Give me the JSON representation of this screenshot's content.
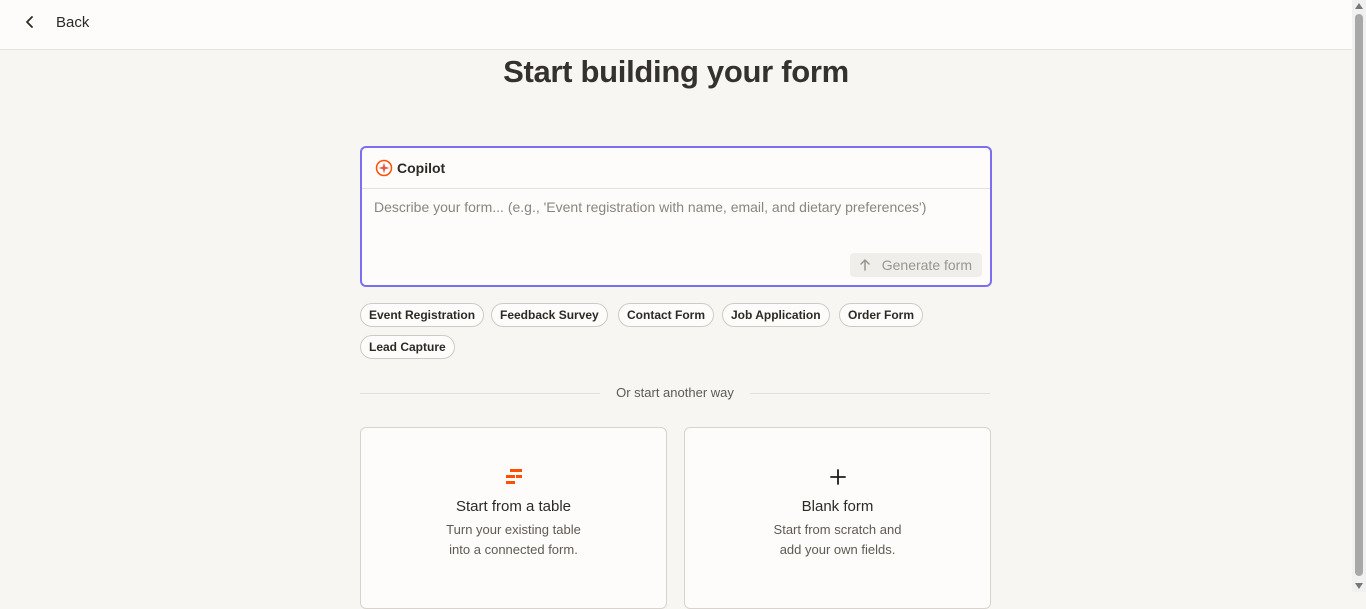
{
  "header": {
    "back_label": "Back"
  },
  "page": {
    "title": "Start building your form"
  },
  "copilot": {
    "name": "Copilot",
    "placeholder": "Describe your form... (e.g., 'Event registration with name, email, and dietary preferences')",
    "value": "",
    "generate_label": "Generate form"
  },
  "templates": [
    "Event Registration",
    "Feedback Survey",
    "Contact Form",
    "Job Application",
    "Order Form",
    "Lead Capture"
  ],
  "divider": {
    "label": "Or start another way"
  },
  "options": [
    {
      "title": "Start from a table",
      "desc1": "Turn your existing table",
      "desc2": "into a connected form.",
      "icon": "table-icon"
    },
    {
      "title": "Blank form",
      "desc1": "Start from scratch and",
      "desc2": "add your own fields.",
      "icon": "plus-icon"
    }
  ],
  "colors": {
    "accent": "#7a6ff0",
    "brand": "#ff4f00",
    "background": "#f7f6f3"
  }
}
